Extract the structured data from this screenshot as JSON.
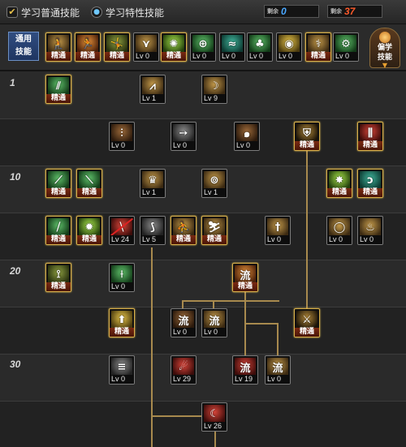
{
  "topbar": {
    "normal_skills_label": "学习普通技能",
    "special_skills_label": "学习特性技能",
    "sp_tag": "剩余",
    "sp_value": "0",
    "tp_tag": "剩余",
    "tp_value": "37",
    "colors": {
      "sp": "#4aa8ff",
      "tp": "#ff5a2a"
    }
  },
  "common": {
    "label_line1": "通用",
    "label_line2": "技能",
    "skills": [
      {
        "icon": "sitting-figure-icon",
        "glyph": "🧎",
        "color": "c-gold",
        "level": "精通",
        "master": true
      },
      {
        "icon": "running-figure-icon",
        "glyph": "🏃",
        "color": "c-orange",
        "level": "精通",
        "master": true
      },
      {
        "icon": "leaping-figure-icon",
        "glyph": "🤸",
        "color": "c-olive",
        "level": "精通",
        "master": true
      },
      {
        "icon": "wings-icon",
        "glyph": "⋎",
        "color": "c-gold",
        "level": "Lv 0",
        "master": false
      },
      {
        "icon": "target-burst-icon",
        "glyph": "✺",
        "color": "c-lime",
        "level": "精通",
        "master": true
      },
      {
        "icon": "crosshair-icon",
        "glyph": "⊕",
        "color": "c-green",
        "level": "Lv 0",
        "master": false
      },
      {
        "icon": "wind-figure-icon",
        "glyph": "≈",
        "color": "c-teal",
        "level": "Lv 0",
        "master": false
      },
      {
        "icon": "mushroom-cloud-icon",
        "glyph": "♣",
        "color": "c-green",
        "level": "Lv 0",
        "master": false
      },
      {
        "icon": "eye-orb-icon",
        "glyph": "◉",
        "color": "c-yellow",
        "level": "Lv 0",
        "master": false
      },
      {
        "icon": "power-up-figure-icon",
        "glyph": "⚕",
        "color": "c-gold",
        "level": "精通",
        "master": true
      },
      {
        "icon": "gear-figure-icon",
        "glyph": "⚙",
        "color": "c-green",
        "level": "Lv 0",
        "master": false
      }
    ],
    "prefer_line1": "偏学",
    "prefer_line2": "技能",
    "prefer_arrow": "▼"
  },
  "tree": {
    "levels": [
      "1",
      "10",
      "20",
      "30"
    ],
    "skills": [
      {
        "icon": "claw-slash-icon",
        "glyph": "⫽",
        "color": "c-green",
        "level": "精通",
        "master": true
      },
      {
        "icon": "blade-upward-icon",
        "glyph": "⩘",
        "color": "c-gold",
        "level": "Lv 1",
        "master": false
      },
      {
        "icon": "crescent-slash-icon",
        "glyph": "☽",
        "color": "c-gold",
        "level": "Lv 9",
        "master": false
      },
      {
        "icon": "triple-blade-icon",
        "glyph": "⫶",
        "color": "c-brown",
        "level": "Lv 0",
        "master": false
      },
      {
        "icon": "arrow-dash-icon",
        "glyph": "➙",
        "color": "c-gray",
        "level": "Lv 0",
        "master": false
      },
      {
        "icon": "whirlwind-icon",
        "glyph": "๑",
        "color": "c-brown",
        "level": "Lv 0",
        "master": false
      },
      {
        "icon": "shield-cross-icon",
        "glyph": "⛨",
        "color": "c-dgold",
        "level": "精通",
        "master": true
      },
      {
        "icon": "triple-sword-icon",
        "glyph": "⫼",
        "color": "c-red",
        "level": "精通",
        "master": true
      },
      {
        "icon": "green-blade-icon",
        "glyph": "⟋",
        "color": "c-green",
        "level": "精通",
        "master": true
      },
      {
        "icon": "green-sword-icon",
        "glyph": "⟍",
        "color": "c-green",
        "level": "精通",
        "master": true
      },
      {
        "icon": "flame-crown-icon",
        "glyph": "♛",
        "color": "c-gold",
        "level": "Lv 1",
        "master": false
      },
      {
        "icon": "swirl-eye-icon",
        "glyph": "⊚",
        "color": "c-gold",
        "level": "Lv 1",
        "master": false
      },
      {
        "icon": "burst-blade-icon",
        "glyph": "✸",
        "color": "c-lime",
        "level": "精通",
        "master": true
      },
      {
        "icon": "hook-blade-icon",
        "glyph": "ↄ",
        "color": "c-teal",
        "level": "精通",
        "master": true
      },
      {
        "icon": "emerald-slash-icon",
        "glyph": "⧸",
        "color": "c-green",
        "level": "精通",
        "master": true
      },
      {
        "icon": "green-star-icon",
        "glyph": "✹",
        "color": "c-lime",
        "level": "精通",
        "master": true
      },
      {
        "icon": "sealed-slash-icon",
        "glyph": "⧹",
        "color": "c-red",
        "level": "Lv 24",
        "master": false,
        "disabled": true
      },
      {
        "icon": "tornado-icon",
        "glyph": "⟆",
        "color": "c-gray",
        "level": "Lv 5",
        "master": false
      },
      {
        "icon": "dash-kick-icon",
        "glyph": "⛹",
        "color": "c-gold",
        "level": "精通",
        "master": true
      },
      {
        "icon": "crouch-strike-icon",
        "glyph": "⛷",
        "color": "c-gold",
        "level": "精通",
        "master": true
      },
      {
        "icon": "sword-cross-icon",
        "glyph": "†",
        "color": "c-gold",
        "level": "Lv 0",
        "master": false
      },
      {
        "icon": "crescent-ring-icon",
        "glyph": "◯",
        "color": "c-gold",
        "level": "Lv 0",
        "master": false
      },
      {
        "icon": "flame-wave-icon",
        "glyph": "♨",
        "color": "c-gold",
        "level": "Lv 0",
        "master": false
      },
      {
        "icon": "tree-branch-icon",
        "glyph": "⟟",
        "color": "c-olive",
        "level": "精通",
        "master": true
      },
      {
        "icon": "vine-blade-icon",
        "glyph": "⟊",
        "color": "c-green",
        "level": "Lv 0",
        "master": false
      },
      {
        "icon": "flow-glyph-icon",
        "glyph": "流",
        "color": "c-orange",
        "level": "精通",
        "master": true
      },
      {
        "icon": "up-arrow-icon",
        "glyph": "⬆",
        "color": "c-yellow",
        "level": "精通",
        "master": true
      },
      {
        "icon": "flow-wave-icon",
        "glyph": "流",
        "color": "c-brown",
        "level": "Lv 0",
        "master": false
      },
      {
        "icon": "flow-sun-icon",
        "glyph": "流",
        "color": "c-gold",
        "level": "Lv 0",
        "master": false
      },
      {
        "icon": "cross-sword-icon",
        "glyph": "⚔",
        "color": "c-dgold",
        "level": "精通",
        "master": true
      },
      {
        "icon": "lines-dash-icon",
        "glyph": "≡",
        "color": "c-gray",
        "level": "Lv 0",
        "master": false
      },
      {
        "icon": "red-swirl-icon",
        "glyph": "☄",
        "color": "c-red",
        "level": "Lv 29",
        "master": false
      },
      {
        "icon": "flow-fire-icon",
        "glyph": "流",
        "color": "c-red",
        "level": "Lv 19",
        "master": false
      },
      {
        "icon": "flow-spark-icon",
        "glyph": "流",
        "color": "c-gold",
        "level": "Lv 0",
        "master": false
      },
      {
        "icon": "red-crescent-icon",
        "glyph": "☾",
        "color": "c-red",
        "level": "Lv 26",
        "master": false
      }
    ]
  }
}
